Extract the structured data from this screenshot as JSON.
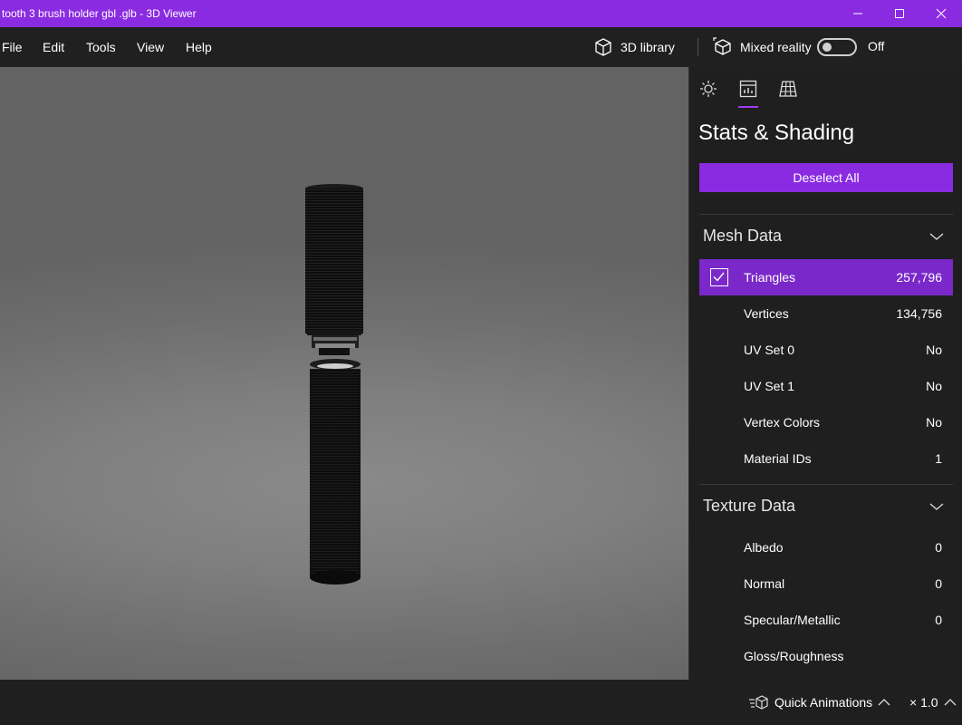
{
  "window": {
    "title": "tooth 3 brush holder gbl .glb - 3D Viewer",
    "minimize_icon": "minimize-icon",
    "maximize_icon": "maximize-icon",
    "close_icon": "close-icon"
  },
  "menu": {
    "file": "File",
    "edit": "Edit",
    "tools": "Tools",
    "view": "View",
    "help": "Help"
  },
  "toolbar": {
    "library_label": "3D library",
    "mixed_reality_label": "Mixed reality",
    "toggle_state": "Off"
  },
  "panel": {
    "tabs": [
      "lighting-tab",
      "stats-tab",
      "grid-tab"
    ],
    "title": "Stats & Shading",
    "deselect_label": "Deselect All",
    "mesh": {
      "heading": "Mesh Data",
      "rows": [
        {
          "label": "Triangles",
          "value": "257,796"
        },
        {
          "label": "Vertices",
          "value": "134,756"
        },
        {
          "label": "UV Set 0",
          "value": "No"
        },
        {
          "label": "UV Set 1",
          "value": "No"
        },
        {
          "label": "Vertex Colors",
          "value": "No"
        },
        {
          "label": "Material IDs",
          "value": "1"
        }
      ]
    },
    "texture": {
      "heading": "Texture Data",
      "rows": [
        {
          "label": "Albedo",
          "value": "0"
        },
        {
          "label": "Normal",
          "value": "0"
        },
        {
          "label": "Specular/Metallic",
          "value": "0"
        },
        {
          "label": "Gloss/Roughness",
          "value": ""
        }
      ]
    }
  },
  "bottom": {
    "quick_animations": "Quick Animations",
    "speed": "× 1.0"
  },
  "colors": {
    "accent": "#8a2be2",
    "selected_row": "#7a28c9"
  }
}
